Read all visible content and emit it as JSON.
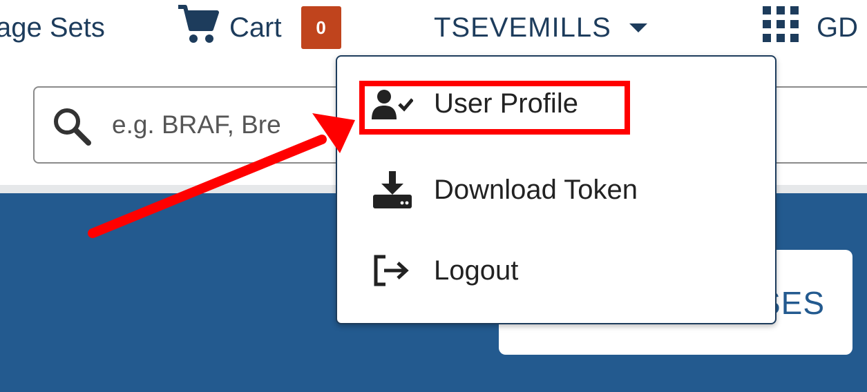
{
  "nav": {
    "image_sets_label": "age Sets",
    "cart_label": "Cart",
    "cart_count": "0",
    "username": "TSEVEMILLS",
    "apps_label": "GD"
  },
  "search": {
    "placeholder": "e.g. BRAF, Bre",
    "value": ""
  },
  "hero": {
    "card_label": "SES"
  },
  "dropdown": {
    "items": [
      {
        "label": "User Profile",
        "icon": "user-check-icon"
      },
      {
        "label": "Download Token",
        "icon": "download-icon"
      },
      {
        "label": "Logout",
        "icon": "logout-icon"
      }
    ]
  },
  "annotation": {
    "color": "#ff0000",
    "highlighted_item": "User Profile"
  },
  "colors": {
    "nav_text": "#1d3c5c",
    "cart_badge": "#c0441d",
    "hero_bg": "#235a8f"
  }
}
